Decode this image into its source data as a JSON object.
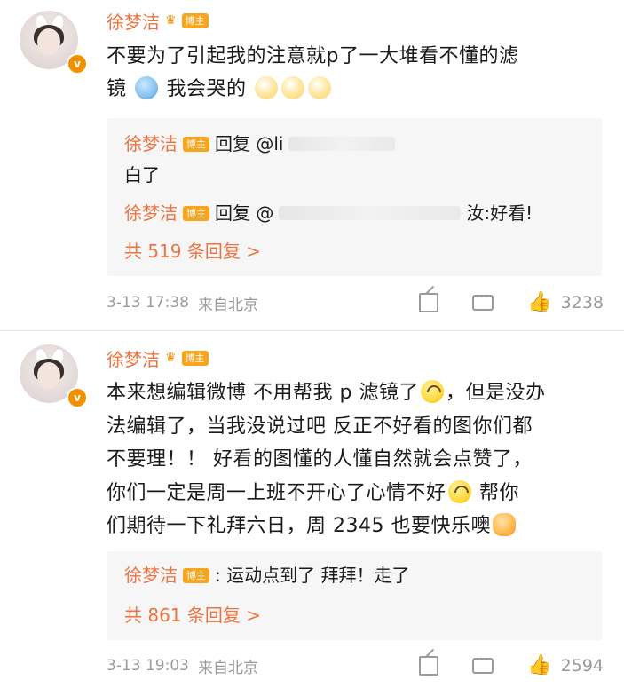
{
  "comments": [
    {
      "user": {
        "name": "徐梦洁",
        "badge": "博主",
        "verified": "v"
      },
      "text_line1": "不要为了引起我的注意就p了一大堆看不懂的滤",
      "text_line2": "镜",
      "text_line2b": "我会哭的",
      "emoji_names": [
        "wave-emoji",
        "face-emoji",
        "face-emoji",
        "face-emoji"
      ],
      "replies": [
        {
          "name": "徐梦洁",
          "badge": "博主",
          "text": "回复 @li"
        },
        {
          "name": "",
          "badge": "",
          "text": "白了"
        },
        {
          "name": "徐梦洁",
          "badge": "博主",
          "text": "回复 @",
          "tail": "汝:好看!"
        }
      ],
      "more_replies": "共 519 条回复 >",
      "timestamp": "3-13 17:38",
      "source": "来自北京",
      "like_count": "3238"
    },
    {
      "user": {
        "name": "徐梦洁",
        "badge": "博主",
        "verified": "v"
      },
      "lines": [
        "本来想编辑微博 不用帮我 p 滤镜了",
        "，但是没办",
        "法编辑了，当我没说过吧 反正不好看的图你们都",
        "不要理！！ 好看的图懂的人懂自然就会点赞了，",
        "你们一定是周一上班不开心了心情不好",
        " 帮你",
        "们期待一下礼拜六日，周 2345 也要快乐噢"
      ],
      "replies": [
        {
          "name": "徐梦洁",
          "badge": "博主",
          "text": ": 运动点到了 拜拜！走了"
        }
      ],
      "more_replies": "共 861 条回复 >",
      "timestamp": "3-13 19:03",
      "source": "来自北京",
      "like_count": "2594"
    }
  ],
  "colors": {
    "accent": "#eb7340",
    "badge": "#f7a51c",
    "meta": "#9a9a9a",
    "reply_bg": "#f6f6f6"
  }
}
